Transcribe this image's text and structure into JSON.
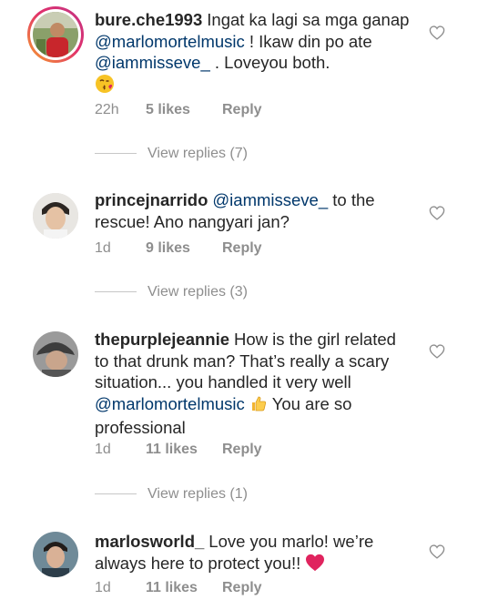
{
  "comments": [
    {
      "username": "bure.che1993",
      "parts": [
        {
          "t": "Ingat ka lagi sa mga ganap "
        },
        {
          "t": "@marlomortelmusic",
          "m": true
        },
        {
          "t": " ! Ikaw din po ate "
        },
        {
          "t": "@iammisseve_",
          "m": true
        },
        {
          "t": " . Loveyou both."
        }
      ],
      "emoji": "kiss-face",
      "time": "22h",
      "likes": "5 likes",
      "reply": "Reply",
      "view_replies": "View replies (7)"
    },
    {
      "username": "princejnarrido",
      "parts": [
        {
          "t": "@iammisseve_",
          "m": true
        },
        {
          "t": "  to the rescue! Ano nangyari jan?"
        }
      ],
      "time": "1d",
      "likes": "9 likes",
      "reply": "Reply",
      "view_replies": "View replies (3)"
    },
    {
      "username": "thepurplejeannie",
      "parts": [
        {
          "t": "How is the girl related to that drunk man? That’s really a scary situation... you handled it very well "
        },
        {
          "t": "@marlomortelmusic",
          "m": true
        },
        {
          "t": " "
        },
        {
          "e": "thumbs-up"
        },
        {
          "t": " You are so professional"
        }
      ],
      "time": "1d",
      "likes": "11 likes",
      "reply": "Reply",
      "view_replies": "View replies (1)"
    },
    {
      "username": "marlosworld_",
      "parts": [
        {
          "t": "Love you marlo! we’re always here to protect you!! "
        },
        {
          "e": "red-heart"
        }
      ],
      "time": "1d",
      "likes": "11 likes",
      "reply": "Reply"
    }
  ],
  "icons": {
    "like": "heart-outline-icon"
  },
  "colors": {
    "mention": "#00376b",
    "meta": "#8e8e8e",
    "text": "#262626"
  }
}
